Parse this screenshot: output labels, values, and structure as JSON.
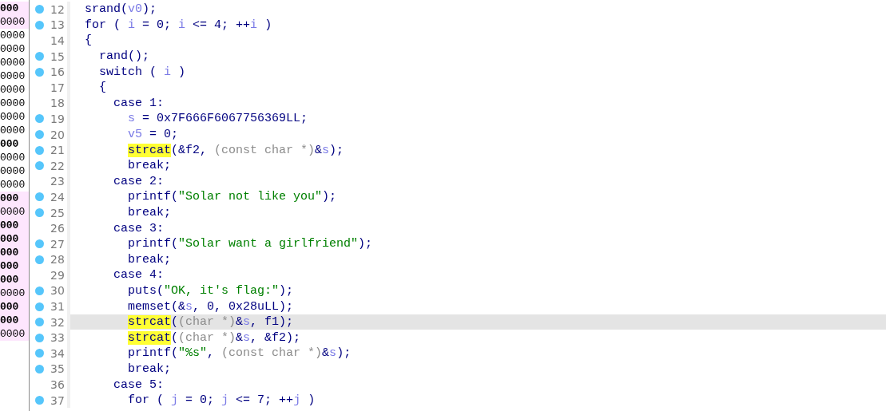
{
  "addresses": [
    {
      "text": "000",
      "bold": true,
      "highlighted": true
    },
    {
      "text": "0000",
      "bold": false,
      "highlighted": true
    },
    {
      "text": "0000",
      "bold": false,
      "highlighted": false
    },
    {
      "text": "0000",
      "bold": false,
      "highlighted": false
    },
    {
      "text": "0000",
      "bold": false,
      "highlighted": false
    },
    {
      "text": "0000",
      "bold": false,
      "highlighted": false
    },
    {
      "text": "0000",
      "bold": false,
      "highlighted": false
    },
    {
      "text": "0000",
      "bold": false,
      "highlighted": false
    },
    {
      "text": "0000",
      "bold": false,
      "highlighted": false
    },
    {
      "text": "0000",
      "bold": false,
      "highlighted": false
    },
    {
      "text": "000",
      "bold": true,
      "highlighted": false
    },
    {
      "text": "0000",
      "bold": false,
      "highlighted": false
    },
    {
      "text": "0000",
      "bold": false,
      "highlighted": false
    },
    {
      "text": "0000",
      "bold": false,
      "highlighted": false
    },
    {
      "text": "000",
      "bold": true,
      "highlighted": true
    },
    {
      "text": "0000",
      "bold": false,
      "highlighted": true
    },
    {
      "text": "000",
      "bold": true,
      "highlighted": true
    },
    {
      "text": "000",
      "bold": true,
      "highlighted": true
    },
    {
      "text": "000",
      "bold": true,
      "highlighted": true
    },
    {
      "text": "000",
      "bold": true,
      "highlighted": true
    },
    {
      "text": "000",
      "bold": true,
      "highlighted": true
    },
    {
      "text": "0000",
      "bold": false,
      "highlighted": true
    },
    {
      "text": "000",
      "bold": true,
      "highlighted": true
    },
    {
      "text": "000",
      "bold": true,
      "highlighted": true
    },
    {
      "text": "0000",
      "bold": false,
      "highlighted": true
    }
  ],
  "lines": [
    {
      "number": "12",
      "dot": true,
      "current": false,
      "tokens": [
        {
          "kind": "code",
          "text": "srand("
        },
        {
          "kind": "var",
          "text": "v0"
        },
        {
          "kind": "code",
          "text": ");"
        }
      ]
    },
    {
      "number": "13",
      "dot": true,
      "current": false,
      "tokens": [
        {
          "kind": "code",
          "text": "for ( "
        },
        {
          "kind": "var",
          "text": "i"
        },
        {
          "kind": "code",
          "text": " = 0; "
        },
        {
          "kind": "var",
          "text": "i"
        },
        {
          "kind": "code",
          "text": " <= 4; ++"
        },
        {
          "kind": "var",
          "text": "i"
        },
        {
          "kind": "code",
          "text": " )"
        }
      ]
    },
    {
      "number": "14",
      "dot": false,
      "current": false,
      "tokens": [
        {
          "kind": "code",
          "text": "{"
        }
      ]
    },
    {
      "number": "15",
      "dot": true,
      "current": false,
      "tokens": [
        {
          "kind": "code",
          "text": "  rand();"
        }
      ]
    },
    {
      "number": "16",
      "dot": true,
      "current": false,
      "tokens": [
        {
          "kind": "code",
          "text": "  switch ( "
        },
        {
          "kind": "var",
          "text": "i"
        },
        {
          "kind": "code",
          "text": " )"
        }
      ]
    },
    {
      "number": "17",
      "dot": false,
      "current": false,
      "tokens": [
        {
          "kind": "code",
          "text": "  {"
        }
      ]
    },
    {
      "number": "18",
      "dot": false,
      "current": false,
      "tokens": [
        {
          "kind": "code",
          "text": "    case 1:"
        }
      ]
    },
    {
      "number": "19",
      "dot": true,
      "current": false,
      "tokens": [
        {
          "kind": "var",
          "text": "      s"
        },
        {
          "kind": "code",
          "text": " = 0x7F666F6067756369LL;"
        }
      ]
    },
    {
      "number": "20",
      "dot": true,
      "current": false,
      "tokens": [
        {
          "kind": "var",
          "text": "      v5"
        },
        {
          "kind": "code",
          "text": " = 0;"
        }
      ]
    },
    {
      "number": "21",
      "dot": true,
      "current": false,
      "tokens": [
        {
          "kind": "match",
          "text": "      strcat"
        },
        {
          "kind": "code",
          "text": "(&f2, "
        },
        {
          "kind": "type",
          "text": "(const char *)"
        },
        {
          "kind": "code",
          "text": "&"
        },
        {
          "kind": "var",
          "text": "s"
        },
        {
          "kind": "code",
          "text": ");"
        }
      ]
    },
    {
      "number": "22",
      "dot": true,
      "current": false,
      "tokens": [
        {
          "kind": "code",
          "text": "      break;"
        }
      ]
    },
    {
      "number": "23",
      "dot": false,
      "current": false,
      "tokens": [
        {
          "kind": "code",
          "text": "    case 2:"
        }
      ]
    },
    {
      "number": "24",
      "dot": true,
      "current": false,
      "tokens": [
        {
          "kind": "code",
          "text": "      printf("
        },
        {
          "kind": "str",
          "text": "\"Solar not like you\""
        },
        {
          "kind": "code",
          "text": ");"
        }
      ]
    },
    {
      "number": "25",
      "dot": true,
      "current": false,
      "tokens": [
        {
          "kind": "code",
          "text": "      break;"
        }
      ]
    },
    {
      "number": "26",
      "dot": false,
      "current": false,
      "tokens": [
        {
          "kind": "code",
          "text": "    case 3:"
        }
      ]
    },
    {
      "number": "27",
      "dot": true,
      "current": false,
      "tokens": [
        {
          "kind": "code",
          "text": "      printf("
        },
        {
          "kind": "str",
          "text": "\"Solar want a girlfriend\""
        },
        {
          "kind": "code",
          "text": ");"
        }
      ]
    },
    {
      "number": "28",
      "dot": true,
      "current": false,
      "tokens": [
        {
          "kind": "code",
          "text": "      break;"
        }
      ]
    },
    {
      "number": "29",
      "dot": false,
      "current": false,
      "tokens": [
        {
          "kind": "code",
          "text": "    case 4:"
        }
      ]
    },
    {
      "number": "30",
      "dot": true,
      "current": false,
      "tokens": [
        {
          "kind": "code",
          "text": "      puts("
        },
        {
          "kind": "str",
          "text": "\"OK, it's flag:\""
        },
        {
          "kind": "code",
          "text": ");"
        }
      ]
    },
    {
      "number": "31",
      "dot": true,
      "current": false,
      "tokens": [
        {
          "kind": "code",
          "text": "      memset(&"
        },
        {
          "kind": "var",
          "text": "s"
        },
        {
          "kind": "code",
          "text": ", 0, 0x28uLL);"
        }
      ]
    },
    {
      "number": "32",
      "dot": true,
      "current": true,
      "tokens": [
        {
          "kind": "match",
          "text": "      strcat"
        },
        {
          "kind": "code",
          "text": "("
        },
        {
          "kind": "type",
          "text": "(char *)"
        },
        {
          "kind": "code",
          "text": "&"
        },
        {
          "kind": "var",
          "text": "s"
        },
        {
          "kind": "code",
          "text": ", f1);"
        }
      ]
    },
    {
      "number": "33",
      "dot": true,
      "current": false,
      "tokens": [
        {
          "kind": "match",
          "text": "      strcat"
        },
        {
          "kind": "code",
          "text": "("
        },
        {
          "kind": "type",
          "text": "(char *)"
        },
        {
          "kind": "code",
          "text": "&"
        },
        {
          "kind": "var",
          "text": "s"
        },
        {
          "kind": "code",
          "text": ", &f2);"
        }
      ]
    },
    {
      "number": "34",
      "dot": true,
      "current": false,
      "tokens": [
        {
          "kind": "code",
          "text": "      printf("
        },
        {
          "kind": "str",
          "text": "\"%s\""
        },
        {
          "kind": "code",
          "text": ", "
        },
        {
          "kind": "type",
          "text": "(const char *)"
        },
        {
          "kind": "code",
          "text": "&"
        },
        {
          "kind": "var",
          "text": "s"
        },
        {
          "kind": "code",
          "text": ");"
        }
      ]
    },
    {
      "number": "35",
      "dot": true,
      "current": false,
      "tokens": [
        {
          "kind": "code",
          "text": "      break;"
        }
      ]
    },
    {
      "number": "36",
      "dot": false,
      "current": false,
      "tokens": [
        {
          "kind": "code",
          "text": "    case 5:"
        }
      ]
    },
    {
      "number": "37",
      "dot": true,
      "current": false,
      "tokens": [
        {
          "kind": "code",
          "text": "      for ( "
        },
        {
          "kind": "var",
          "text": "j"
        },
        {
          "kind": "code",
          "text": " = 0; "
        },
        {
          "kind": "var",
          "text": "j"
        },
        {
          "kind": "code",
          "text": " <= 7; ++"
        },
        {
          "kind": "var",
          "text": "j"
        },
        {
          "kind": "code",
          "text": " )"
        }
      ]
    }
  ]
}
